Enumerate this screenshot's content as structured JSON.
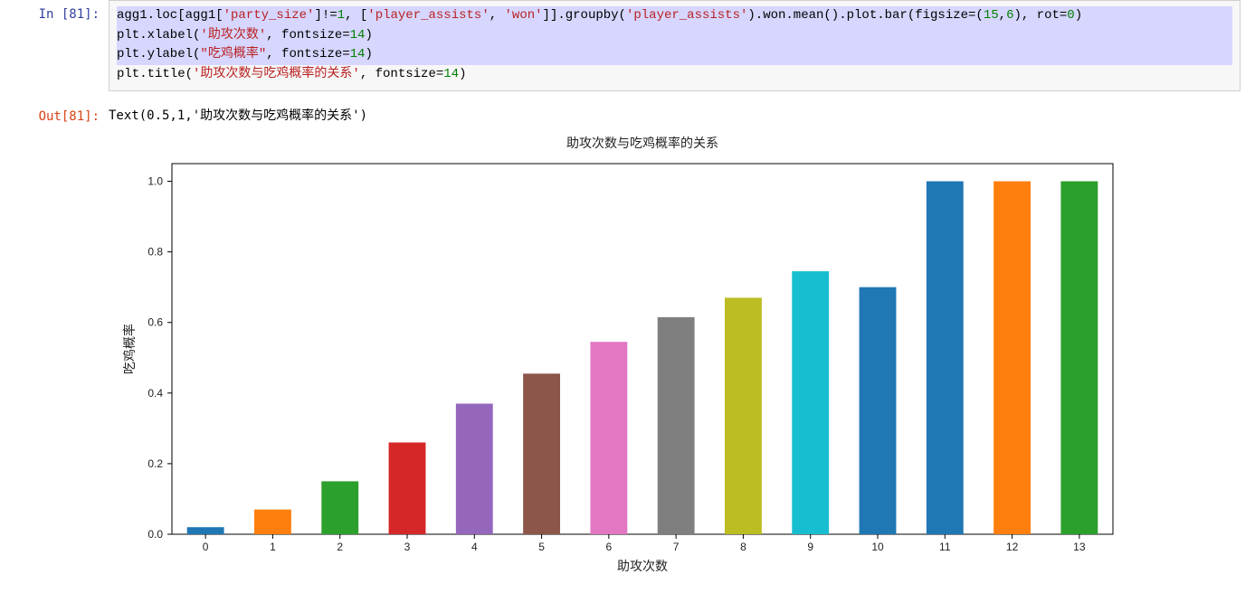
{
  "prompts": {
    "in_label": "In  [81]:",
    "out_label": "Out[81]:"
  },
  "code": {
    "line1_a": "agg1.loc[agg1[",
    "line1_s1": "'party_size'",
    "line1_b": "]!=",
    "line1_n1": "1",
    "line1_c": ", [",
    "line1_s2": "'player_assists'",
    "line1_d": ", ",
    "line1_s3": "'won'",
    "line1_e": "]].groupby(",
    "line1_s4": "'player_assists'",
    "line1_f": ").won.mean().plot.bar(figsize=(",
    "line1_n2": "15",
    "line1_g": ",",
    "line1_n3": "6",
    "line1_h": "), rot=",
    "line1_n4": "0",
    "line1_i": ")",
    "line2_a": "plt.xlabel(",
    "line2_s1": "'助攻次数'",
    "line2_b": ", fontsize=",
    "line2_n1": "14",
    "line2_c": ")",
    "line3_a": "plt.ylabel(",
    "line3_s1": "\"吃鸡概率\"",
    "line3_b": ", fontsize=",
    "line3_n1": "14",
    "line3_c": ")",
    "line4_a": "plt.title(",
    "line4_s1": "'助攻次数与吃鸡概率的关系'",
    "line4_b": ", fontsize=",
    "line4_n1": "14",
    "line4_c": ")"
  },
  "output_text": "Text(0.5,1,'助攻次数与吃鸡概率的关系')",
  "chart_data": {
    "type": "bar",
    "title": "助攻次数与吃鸡概率的关系",
    "xlabel": "助攻次数",
    "ylabel": "吃鸡概率",
    "categories": [
      "0",
      "1",
      "2",
      "3",
      "4",
      "5",
      "6",
      "7",
      "8",
      "9",
      "10",
      "11",
      "12",
      "13"
    ],
    "values": [
      0.02,
      0.07,
      0.15,
      0.26,
      0.37,
      0.455,
      0.545,
      0.615,
      0.67,
      0.745,
      0.7,
      1.0,
      1.0,
      1.0
    ],
    "colors": [
      "#1f77b4",
      "#ff7f0e",
      "#2ca02c",
      "#d62728",
      "#9467bd",
      "#8c564b",
      "#e377c2",
      "#7f7f7f",
      "#bcbd22",
      "#17becf",
      "#1f77b4",
      "#1f77b4",
      "#ff7f0e",
      "#2ca02c"
    ],
    "yticks": [
      0.0,
      0.2,
      0.4,
      0.6,
      0.8,
      1.0
    ],
    "ylim": [
      0,
      1.05
    ]
  }
}
